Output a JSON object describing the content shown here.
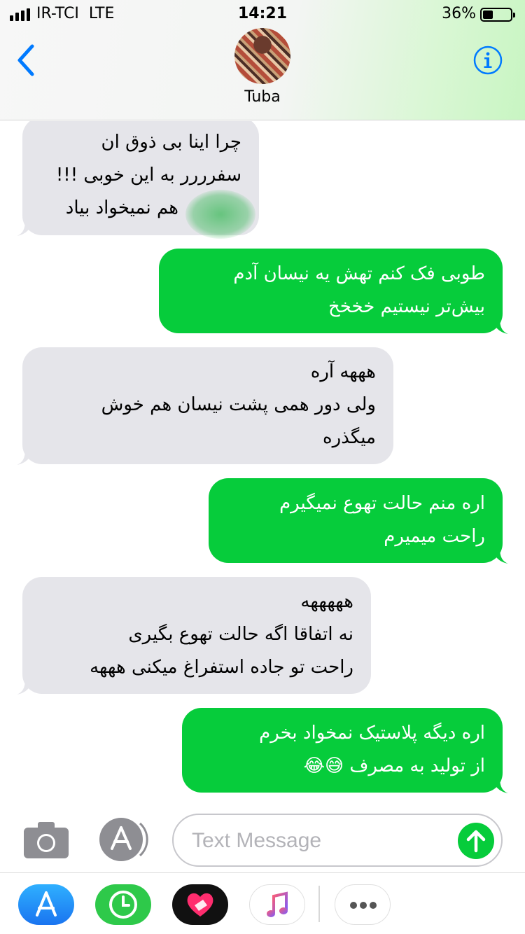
{
  "status_bar": {
    "carrier": "IR-TCI",
    "network": "LTE",
    "time": "14:21",
    "battery_percent": "36%",
    "battery_level": 0.36
  },
  "header": {
    "contact_name": "Tuba",
    "accent_color": "#007aff"
  },
  "messages": [
    {
      "direction": "incoming",
      "lines": [
        "چرا اینا بی ذوق ان",
        "سفرررر به این خوبی !!!",
        "هم نمیخواد بیاد"
      ]
    },
    {
      "direction": "outgoing",
      "lines": [
        "طوبی فک کنم تهش یه نیسان آدم",
        "بیش‌تر نیستیم خخخخ"
      ]
    },
    {
      "direction": "incoming",
      "lines": [
        "هههه آره",
        "ولی دور همی پشت نیسان هم خوش",
        "میگذره"
      ]
    },
    {
      "direction": "outgoing",
      "lines": [
        "اره منم حالت تهوع نمیگیرم",
        "راحت میمیرم"
      ]
    },
    {
      "direction": "incoming",
      "lines": [
        "هههههه",
        "نه اتفاقا اگه حالت تهوع بگیری",
        "راحت تو جاده استفراغ میکنی هههه"
      ]
    },
    {
      "direction": "outgoing",
      "lines": [
        "اره دیگه پلاستیک نمخواد بخرم",
        "از تولید به مصرف 😅😂"
      ]
    }
  ],
  "colors": {
    "incoming_bubble": "#e5e5ea",
    "outgoing_bubble": "#06cc3b"
  },
  "composer": {
    "placeholder": "Text Message"
  },
  "drawer": {
    "apps": [
      "app-store",
      "activity",
      "digital-touch",
      "music",
      "more"
    ]
  }
}
